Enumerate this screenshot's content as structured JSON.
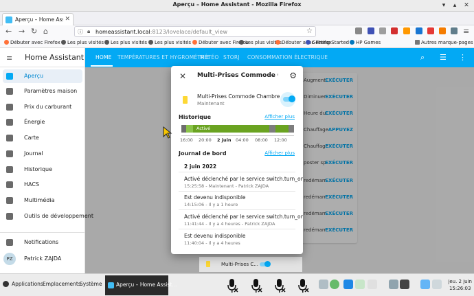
{
  "window": {
    "title": "Aperçu – Home Assistant - Mozilla Firefox"
  },
  "browser": {
    "tab_label": "Aperçu – Home Assistant",
    "url_host": "homeassistant.local",
    "url_path": ":8123/lovelace/default_view",
    "bookmarks": [
      "Débuter avec Firefox",
      "Les plus visités",
      "Les plus visités",
      "Les plus visités",
      "Débuter avec Firefox",
      "Les plus visités",
      "Débuter avec Firefox",
      "Getting Started",
      "HP Games"
    ],
    "other_bookmarks": "Autres marque-pages"
  },
  "ha": {
    "app_name": "Home Assistant",
    "sidebar": {
      "items": [
        {
          "label": "Aperçu",
          "icon": "dashboard-icon"
        },
        {
          "label": "Paramètres maison",
          "icon": "dashboard-icon"
        },
        {
          "label": "Prix du carburant",
          "icon": "dashboard-icon"
        },
        {
          "label": "Énergie",
          "icon": "lightning-icon"
        },
        {
          "label": "Carte",
          "icon": "map-icon"
        },
        {
          "label": "Journal",
          "icon": "list-icon"
        },
        {
          "label": "Historique",
          "icon": "chart-icon"
        },
        {
          "label": "HACS",
          "icon": "hacs-icon"
        },
        {
          "label": "Multimédia",
          "icon": "media-icon"
        },
        {
          "label": "Outils de développement",
          "icon": "hammer-icon"
        }
      ],
      "notifications": "Notifications",
      "user_initials": "PZ",
      "user_name": "Patrick ZAJDA"
    },
    "tabs": [
      "HOME",
      "TEMPÉRATURES ET HYGROMÉTRIE",
      "MÉTÉO",
      "STORJ",
      "CONSOMMATION ÉLECTRIQUE"
    ],
    "background_rows": [
      {
        "text": "Augment...",
        "action": "EXÉCUTER"
      },
      {
        "text": "Diminuer ...",
        "action": "EXÉCUTER"
      },
      {
        "text": "Heure du ...",
        "action": "EXÉCUTER"
      },
      {
        "text": "Chauffage...",
        "action": "APPUYEZ"
      },
      {
        "text": "Chauffage...",
        "action": "EXÉCUTER"
      },
      {
        "text": "poster sp...",
        "action": "EXÉCUTER"
      },
      {
        "text": "redémarr...",
        "action": "EXÉCUTER"
      },
      {
        "text": "redémarr...",
        "action": "EXÉCUTER"
      },
      {
        "text": "redémarr...",
        "action": "EXÉCUTER"
      },
      {
        "text": "redémarr...",
        "action": "EXÉCUTER"
      }
    ],
    "below_card": {
      "label": "Multi-Prises C..."
    }
  },
  "dialog": {
    "title": "Multi-Prises Commode Cha...",
    "entity_name": "Multi-Prises Commode Chambre",
    "entity_state": "Maintenant",
    "toggle_on": true,
    "history_title": "Historique",
    "history_link": "Afficher plus",
    "history_active_label": "Activé",
    "history_ticks": [
      "16:00",
      "20:00",
      "2 juin",
      "04:00",
      "08:00",
      "12:00"
    ],
    "logbook_title": "Journal de bord",
    "logbook_link": "Afficher plus",
    "logbook_date": "2 juin 2022",
    "logbook_entries": [
      {
        "message": "Activé déclenché par le service switch.turn_on",
        "meta": "15:25:58 - Maintenant - Patrick ZAJDA"
      },
      {
        "message": "Est devenu indisponible",
        "meta": "14:15:06 - Il y a 1 heure"
      },
      {
        "message": "Activé déclenché par le service switch.turn_on",
        "meta": "11:41:44 - Il y a 4 heures - Patrick ZAJDA"
      },
      {
        "message": "Est devenu indisponible",
        "meta": "11:40:04 - Il y a 4 heures"
      }
    ]
  },
  "taskbar": {
    "applications": "Applications",
    "places": "Emplacements",
    "system": "Système",
    "window_label": "Aperçu – Home Assist...",
    "clock_date": "jeu. 2 juin",
    "clock_time": "15:26:03"
  },
  "colors": {
    "accent": "#03a9f4",
    "active_state": "#4caf50",
    "unavailable_state": "#6d6d6d"
  }
}
